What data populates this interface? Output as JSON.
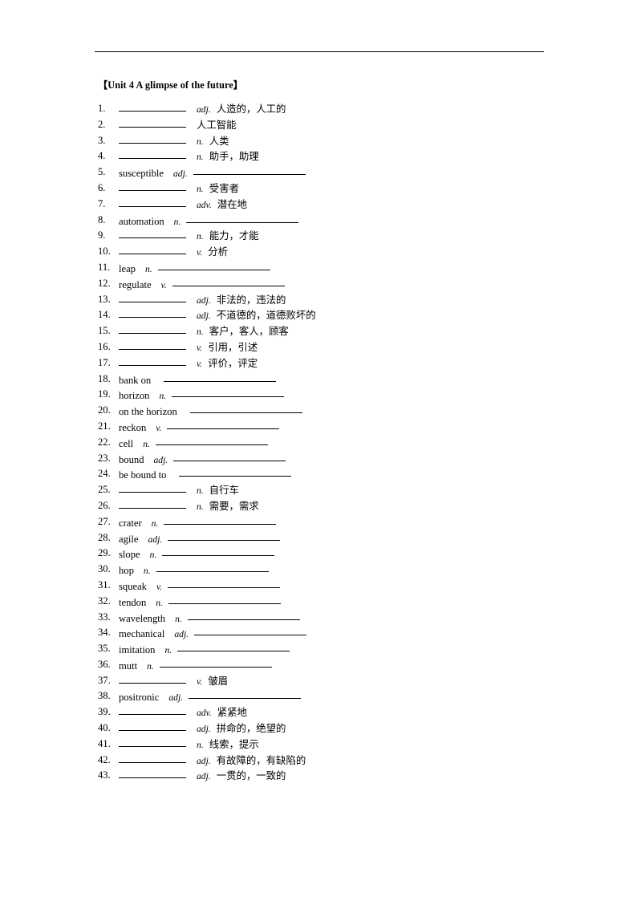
{
  "document": {
    "title": "【Unit 4 A glimpse of the future】",
    "has_header_rule": true
  },
  "items": [
    {
      "num": "1.",
      "layout": "blank-first",
      "word": "",
      "pos": "adj.",
      "gloss": "人造的，人工的"
    },
    {
      "num": "2.",
      "layout": "blank-first",
      "word": "",
      "pos": "",
      "gloss": "人工智能"
    },
    {
      "num": "3.",
      "layout": "blank-first",
      "word": "",
      "pos": "n.",
      "gloss": "人类"
    },
    {
      "num": "4.",
      "layout": "blank-first",
      "word": "",
      "pos": "n.",
      "gloss": "助手，助理"
    },
    {
      "num": "5.",
      "layout": "word-first",
      "word": "susceptible",
      "pos": "adj.",
      "gloss": ""
    },
    {
      "num": "6.",
      "layout": "blank-first",
      "word": "",
      "pos": "n.",
      "gloss": "受害者"
    },
    {
      "num": "7.",
      "layout": "blank-first",
      "word": "",
      "pos": "adv.",
      "gloss": "潜在地"
    },
    {
      "num": "8.",
      "layout": "word-first",
      "word": "automation",
      "pos": "n.",
      "gloss": ""
    },
    {
      "num": "9.",
      "layout": "blank-first",
      "word": "",
      "pos": "n.",
      "gloss": "能力，才能"
    },
    {
      "num": "10.",
      "layout": "blank-first",
      "word": "",
      "pos": "v.",
      "gloss": "分析"
    },
    {
      "num": "11.",
      "layout": "word-first",
      "word": "leap",
      "pos": "n.",
      "gloss": ""
    },
    {
      "num": "12.",
      "layout": "word-first",
      "word": "regulate",
      "pos": "v.",
      "gloss": ""
    },
    {
      "num": "13.",
      "layout": "blank-first",
      "word": "",
      "pos": "adj.",
      "gloss": "非法的，违法的"
    },
    {
      "num": "14.",
      "layout": "blank-first",
      "word": "",
      "pos": "adj.",
      "gloss": "不道德的，道德败坏的"
    },
    {
      "num": "15.",
      "layout": "blank-first",
      "word": "",
      "pos": "n.",
      "gloss": "客户，客人，顾客"
    },
    {
      "num": "16.",
      "layout": "blank-first",
      "word": "",
      "pos": "v.",
      "gloss": "引用，引述"
    },
    {
      "num": "17.",
      "layout": "blank-first",
      "word": "",
      "pos": "v.",
      "gloss": "评价，评定"
    },
    {
      "num": "18.",
      "layout": "word-first",
      "word": "bank on",
      "pos": "",
      "gloss": ""
    },
    {
      "num": "19.",
      "layout": "word-first",
      "word": "horizon",
      "pos": "n.",
      "gloss": ""
    },
    {
      "num": "20.",
      "layout": "word-first",
      "word": "on the horizon",
      "pos": "",
      "gloss": ""
    },
    {
      "num": "21.",
      "layout": "word-first",
      "word": "reckon",
      "pos": "v.",
      "gloss": ""
    },
    {
      "num": "22.",
      "layout": "word-first",
      "word": "cell",
      "pos": "n.",
      "gloss": ""
    },
    {
      "num": "23.",
      "layout": "word-first",
      "word": "bound",
      "pos": "adj.",
      "gloss": ""
    },
    {
      "num": "24.",
      "layout": "word-first",
      "word": "be bound to",
      "pos": "",
      "gloss": ""
    },
    {
      "num": "25.",
      "layout": "blank-first",
      "word": "",
      "pos": "n.",
      "gloss": "自行车"
    },
    {
      "num": "26.",
      "layout": "blank-first",
      "word": "",
      "pos": "n.",
      "gloss": "需要，需求"
    },
    {
      "num": "27.",
      "layout": "word-first",
      "word": "crater",
      "pos": "n.",
      "gloss": ""
    },
    {
      "num": "28.",
      "layout": "word-first",
      "word": "agile",
      "pos": "adj.",
      "gloss": ""
    },
    {
      "num": "29.",
      "layout": "word-first",
      "word": "slope",
      "pos": "n.",
      "gloss": ""
    },
    {
      "num": "30.",
      "layout": "word-first",
      "word": "hop",
      "pos": "n.",
      "gloss": ""
    },
    {
      "num": "31.",
      "layout": "word-first",
      "word": "squeak",
      "pos": "v.",
      "gloss": ""
    },
    {
      "num": "32.",
      "layout": "word-first",
      "word": "tendon",
      "pos": "n.",
      "gloss": ""
    },
    {
      "num": "33.",
      "layout": "word-first",
      "word": "wavelength",
      "pos": "n.",
      "gloss": ""
    },
    {
      "num": "34.",
      "layout": "word-first",
      "word": "mechanical",
      "pos": "adj.",
      "gloss": ""
    },
    {
      "num": "35.",
      "layout": "word-first",
      "word": "imitation",
      "pos": "n.",
      "gloss": ""
    },
    {
      "num": "36.",
      "layout": "word-first",
      "word": "mutt",
      "pos": "n.",
      "gloss": ""
    },
    {
      "num": "37.",
      "layout": "blank-first",
      "word": "",
      "pos": "v.",
      "gloss": "皱眉"
    },
    {
      "num": "38.",
      "layout": "word-first",
      "word": "positronic",
      "pos": "adj.",
      "gloss": ""
    },
    {
      "num": "39.",
      "layout": "blank-first",
      "word": "",
      "pos": "adv.",
      "gloss": "紧紧地"
    },
    {
      "num": "40.",
      "layout": "blank-first",
      "word": "",
      "pos": "adj.",
      "gloss": "拼命的，绝望的"
    },
    {
      "num": "41.",
      "layout": "blank-first",
      "word": "",
      "pos": "n.",
      "gloss": "线索，提示"
    },
    {
      "num": "42.",
      "layout": "blank-first",
      "word": "",
      "pos": "adj.",
      "gloss": "有故障的，有缺陷的"
    },
    {
      "num": "43.",
      "layout": "blank-first",
      "word": "",
      "pos": "adj.",
      "gloss": "一贯的，一致的"
    }
  ]
}
